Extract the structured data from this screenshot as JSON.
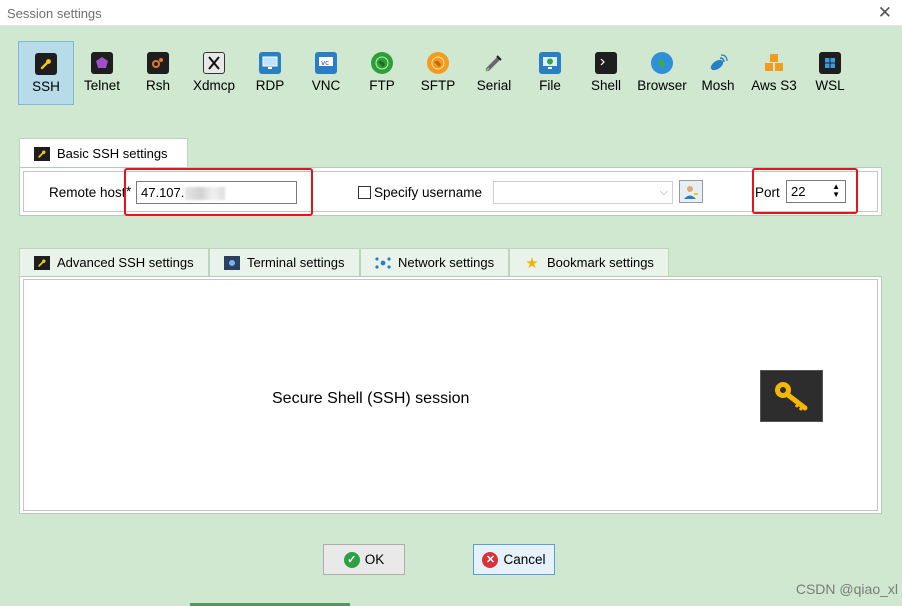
{
  "window": {
    "title": "Session settings"
  },
  "session_types": [
    {
      "label": "SSH",
      "icon": "wrench-icon"
    },
    {
      "label": "Telnet",
      "icon": "telnet-icon"
    },
    {
      "label": "Rsh",
      "icon": "rsh-icon"
    },
    {
      "label": "Xdmcp",
      "icon": "xdmcp-icon"
    },
    {
      "label": "RDP",
      "icon": "rdp-icon"
    },
    {
      "label": "VNC",
      "icon": "vnc-icon"
    },
    {
      "label": "FTP",
      "icon": "ftp-globe-icon"
    },
    {
      "label": "SFTP",
      "icon": "sftp-globe-icon"
    },
    {
      "label": "Serial",
      "icon": "serial-plug-icon"
    },
    {
      "label": "File",
      "icon": "file-monitor-icon"
    },
    {
      "label": "Shell",
      "icon": "terminal-icon"
    },
    {
      "label": "Browser",
      "icon": "browser-globe-icon"
    },
    {
      "label": "Mosh",
      "icon": "satellite-icon"
    },
    {
      "label": "Aws S3",
      "icon": "aws-cubes-icon"
    },
    {
      "label": "WSL",
      "icon": "windows-icon"
    }
  ],
  "basic_settings": {
    "tab_label": "Basic SSH settings",
    "remote_host_label": "Remote host",
    "remote_host_required_mark": "*",
    "remote_host_value": "47.107.",
    "specify_username_label": "Specify username",
    "specify_username_checked": false,
    "username_value": "",
    "port_label": "Port",
    "port_value": "22"
  },
  "settings_tabs": [
    {
      "label": "Advanced SSH settings",
      "icon": "wrench-icon"
    },
    {
      "label": "Terminal settings",
      "icon": "terminal-settings-icon"
    },
    {
      "label": "Network settings",
      "icon": "network-icon"
    },
    {
      "label": "Bookmark settings",
      "icon": "star-icon"
    }
  ],
  "description": "Secure Shell (SSH) session",
  "buttons": {
    "ok": "OK",
    "cancel": "Cancel"
  },
  "watermark": "CSDN @qiao_xl",
  "colors": {
    "background": "#cfe8cf",
    "highlight": "#e8141a",
    "selected": "#b7dbe9"
  }
}
